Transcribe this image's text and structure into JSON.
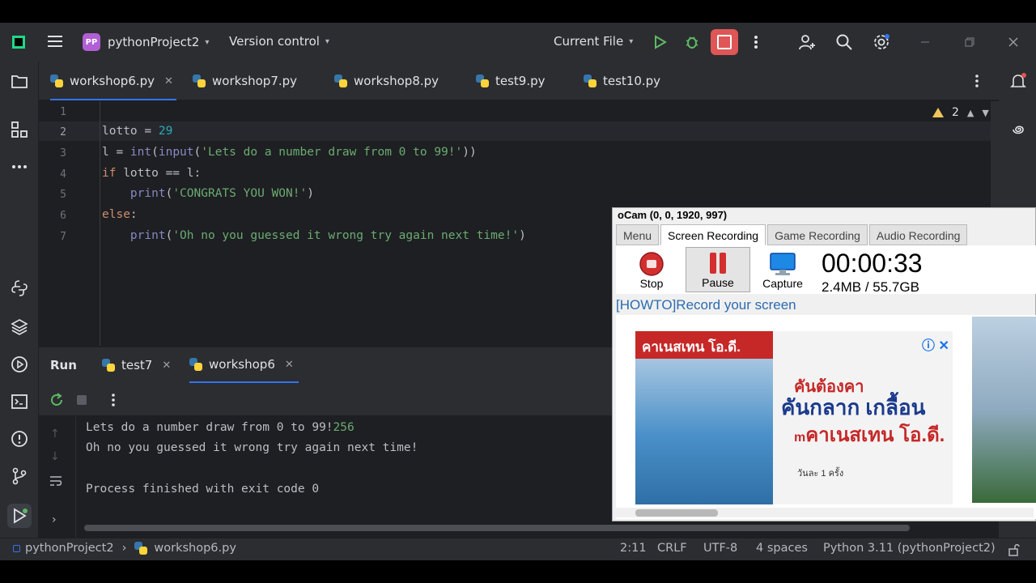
{
  "titlebar": {
    "project_badge": "PP",
    "project_name": "pythonProject2",
    "version_control": "Version control",
    "run_config": "Current File"
  },
  "tabs": [
    {
      "label": "workshop6.py",
      "active": true
    },
    {
      "label": "workshop7.py"
    },
    {
      "label": "workshop8.py"
    },
    {
      "label": "test9.py"
    },
    {
      "label": "test10.py"
    }
  ],
  "editor": {
    "line_numbers": [
      "1",
      "2",
      "3",
      "4",
      "5",
      "6",
      "7"
    ],
    "warnings_count": "2",
    "lines": [
      "",
      "lotto = 29",
      "l = int(input('Lets do a number draw from 0 to 99!'))",
      "if lotto == l:",
      "    print('CONGRATS YOU WON!')",
      "else:",
      "    print('Oh no you guessed it wrong try again next time!')"
    ]
  },
  "run_panel": {
    "title": "Run",
    "tabs": [
      {
        "label": "test7"
      },
      {
        "label": "workshop6",
        "active": true
      }
    ],
    "console": {
      "prompt": "Lets do a number draw from 0 to 99!",
      "user_input": "256",
      "line2": "Oh no you guessed it wrong try again next time!",
      "line3": "",
      "line4": "Process finished with exit code 0"
    }
  },
  "statusbar": {
    "project": "pythonProject2",
    "file": "workshop6.py",
    "position": "2:11",
    "line_ending": "CRLF",
    "encoding": "UTF-8",
    "indent": "4 spaces",
    "interpreter": "Python 3.11 (pythonProject2)"
  },
  "ocam": {
    "title": "oCam (0, 0, 1920, 997)",
    "tabs": [
      "Menu",
      "Screen Recording",
      "Game Recording",
      "Audio Recording"
    ],
    "buttons": {
      "stop": "Stop",
      "pause": "Pause",
      "capture": "Capture"
    },
    "timer": "00:00:33",
    "size": "2.4MB / 55.7GB",
    "link": "[HOWTO]Record your screen",
    "ad": {
      "brand": "คาเนสเทน",
      "brand_suffix": "โอ.ดี.",
      "line1": "คันต้องคา",
      "line2": "คันกลาก เกลื้อน",
      "line3_prefix": "m",
      "line3": "คาเนสเทน โอ.ดี.",
      "small": "วันละ 1 ครั้ง"
    }
  },
  "colors": {
    "accent": "#3574f0",
    "stop_button": "#e05555",
    "run_green": "#5fb865",
    "string": "#6aab73",
    "keyword": "#cf8e6d",
    "number": "#2aacb8"
  }
}
